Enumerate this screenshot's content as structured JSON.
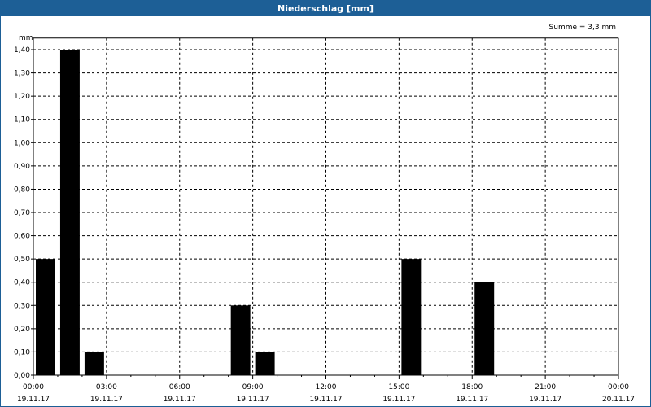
{
  "window": {
    "title": "Niederschlag [mm]"
  },
  "summary": "Summe = 3,3 mm",
  "colors": {
    "titlebar": "#1d5f96",
    "bar": "#000000",
    "grid": "#000000"
  },
  "chart_data": {
    "type": "bar",
    "title": "Niederschlag [mm]",
    "ylabel": "mm",
    "xlabel": "",
    "ylim": [
      0,
      1.45
    ],
    "grid": true,
    "y_ticks": [
      "0,00",
      "0,10",
      "0,20",
      "0,30",
      "0,40",
      "0,50",
      "0,60",
      "0,70",
      "0,80",
      "0,90",
      "1,00",
      "1,10",
      "1,20",
      "1,30",
      "1,40"
    ],
    "x_ticks": [
      {
        "time": "00:00",
        "date": "19.11.17"
      },
      {
        "time": "03:00",
        "date": "19.11.17"
      },
      {
        "time": "06:00",
        "date": "19.11.17"
      },
      {
        "time": "09:00",
        "date": "19.11.17"
      },
      {
        "time": "12:00",
        "date": "19.11.17"
      },
      {
        "time": "15:00",
        "date": "19.11.17"
      },
      {
        "time": "18:00",
        "date": "19.11.17"
      },
      {
        "time": "21:00",
        "date": "19.11.17"
      },
      {
        "time": "00:00",
        "date": "20.11.17"
      }
    ],
    "x_range_hours": [
      0,
      24
    ],
    "bar_width_hours": 1,
    "bars": [
      {
        "start_hour": 0,
        "value": 0.5
      },
      {
        "start_hour": 1,
        "value": 1.4
      },
      {
        "start_hour": 2,
        "value": 0.1
      },
      {
        "start_hour": 8,
        "value": 0.3
      },
      {
        "start_hour": 9,
        "value": 0.1
      },
      {
        "start_hour": 15,
        "value": 0.5
      },
      {
        "start_hour": 18,
        "value": 0.4
      }
    ]
  }
}
